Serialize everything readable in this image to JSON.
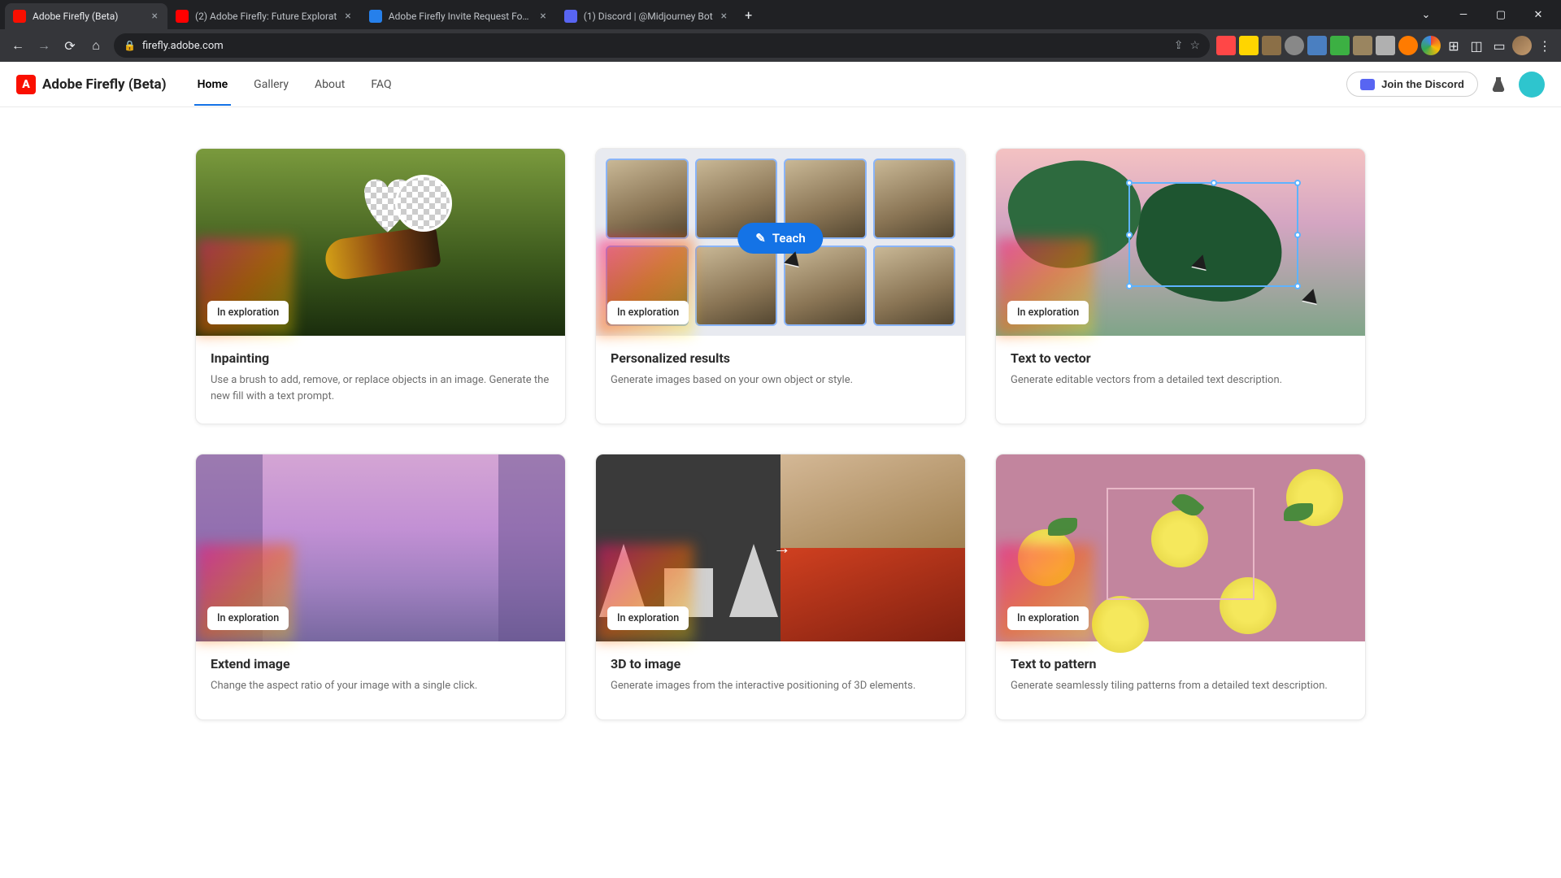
{
  "browser": {
    "tabs": [
      {
        "title": "Adobe Firefly (Beta)",
        "active": true,
        "favicon": "#fa0f00"
      },
      {
        "title": "(2) Adobe Firefly: Future Explorat",
        "active": false,
        "favicon": "#ff0000"
      },
      {
        "title": "Adobe Firefly Invite Request Form",
        "active": false,
        "favicon": "#2680eb"
      },
      {
        "title": "(1) Discord | @Midjourney Bot",
        "active": false,
        "favicon": "#5865F2"
      }
    ],
    "url": "firefly.adobe.com"
  },
  "header": {
    "logo_text": "Adobe Firefly (Beta)",
    "nav": [
      {
        "label": "Home",
        "active": true
      },
      {
        "label": "Gallery",
        "active": false
      },
      {
        "label": "About",
        "active": false
      },
      {
        "label": "FAQ",
        "active": false
      }
    ],
    "discord_label": "Join the Discord"
  },
  "cards": [
    {
      "badge": "In exploration",
      "title": "Inpainting",
      "desc": "Use a brush to add, remove, or replace objects in an image. Generate the new fill with a text prompt."
    },
    {
      "badge": "In exploration",
      "title": "Personalized results",
      "desc": "Generate images based on your own object or style.",
      "button": "Teach"
    },
    {
      "badge": "In exploration",
      "title": "Text to vector",
      "desc": "Generate editable vectors from a detailed text description."
    },
    {
      "badge": "In exploration",
      "title": "Extend image",
      "desc": "Change the aspect ratio of your image with a single click."
    },
    {
      "badge": "In exploration",
      "title": "3D to image",
      "desc": "Generate images from the interactive positioning of 3D elements."
    },
    {
      "badge": "In exploration",
      "title": "Text to pattern",
      "desc": "Generate seamlessly tiling patterns from a detailed text description."
    }
  ]
}
